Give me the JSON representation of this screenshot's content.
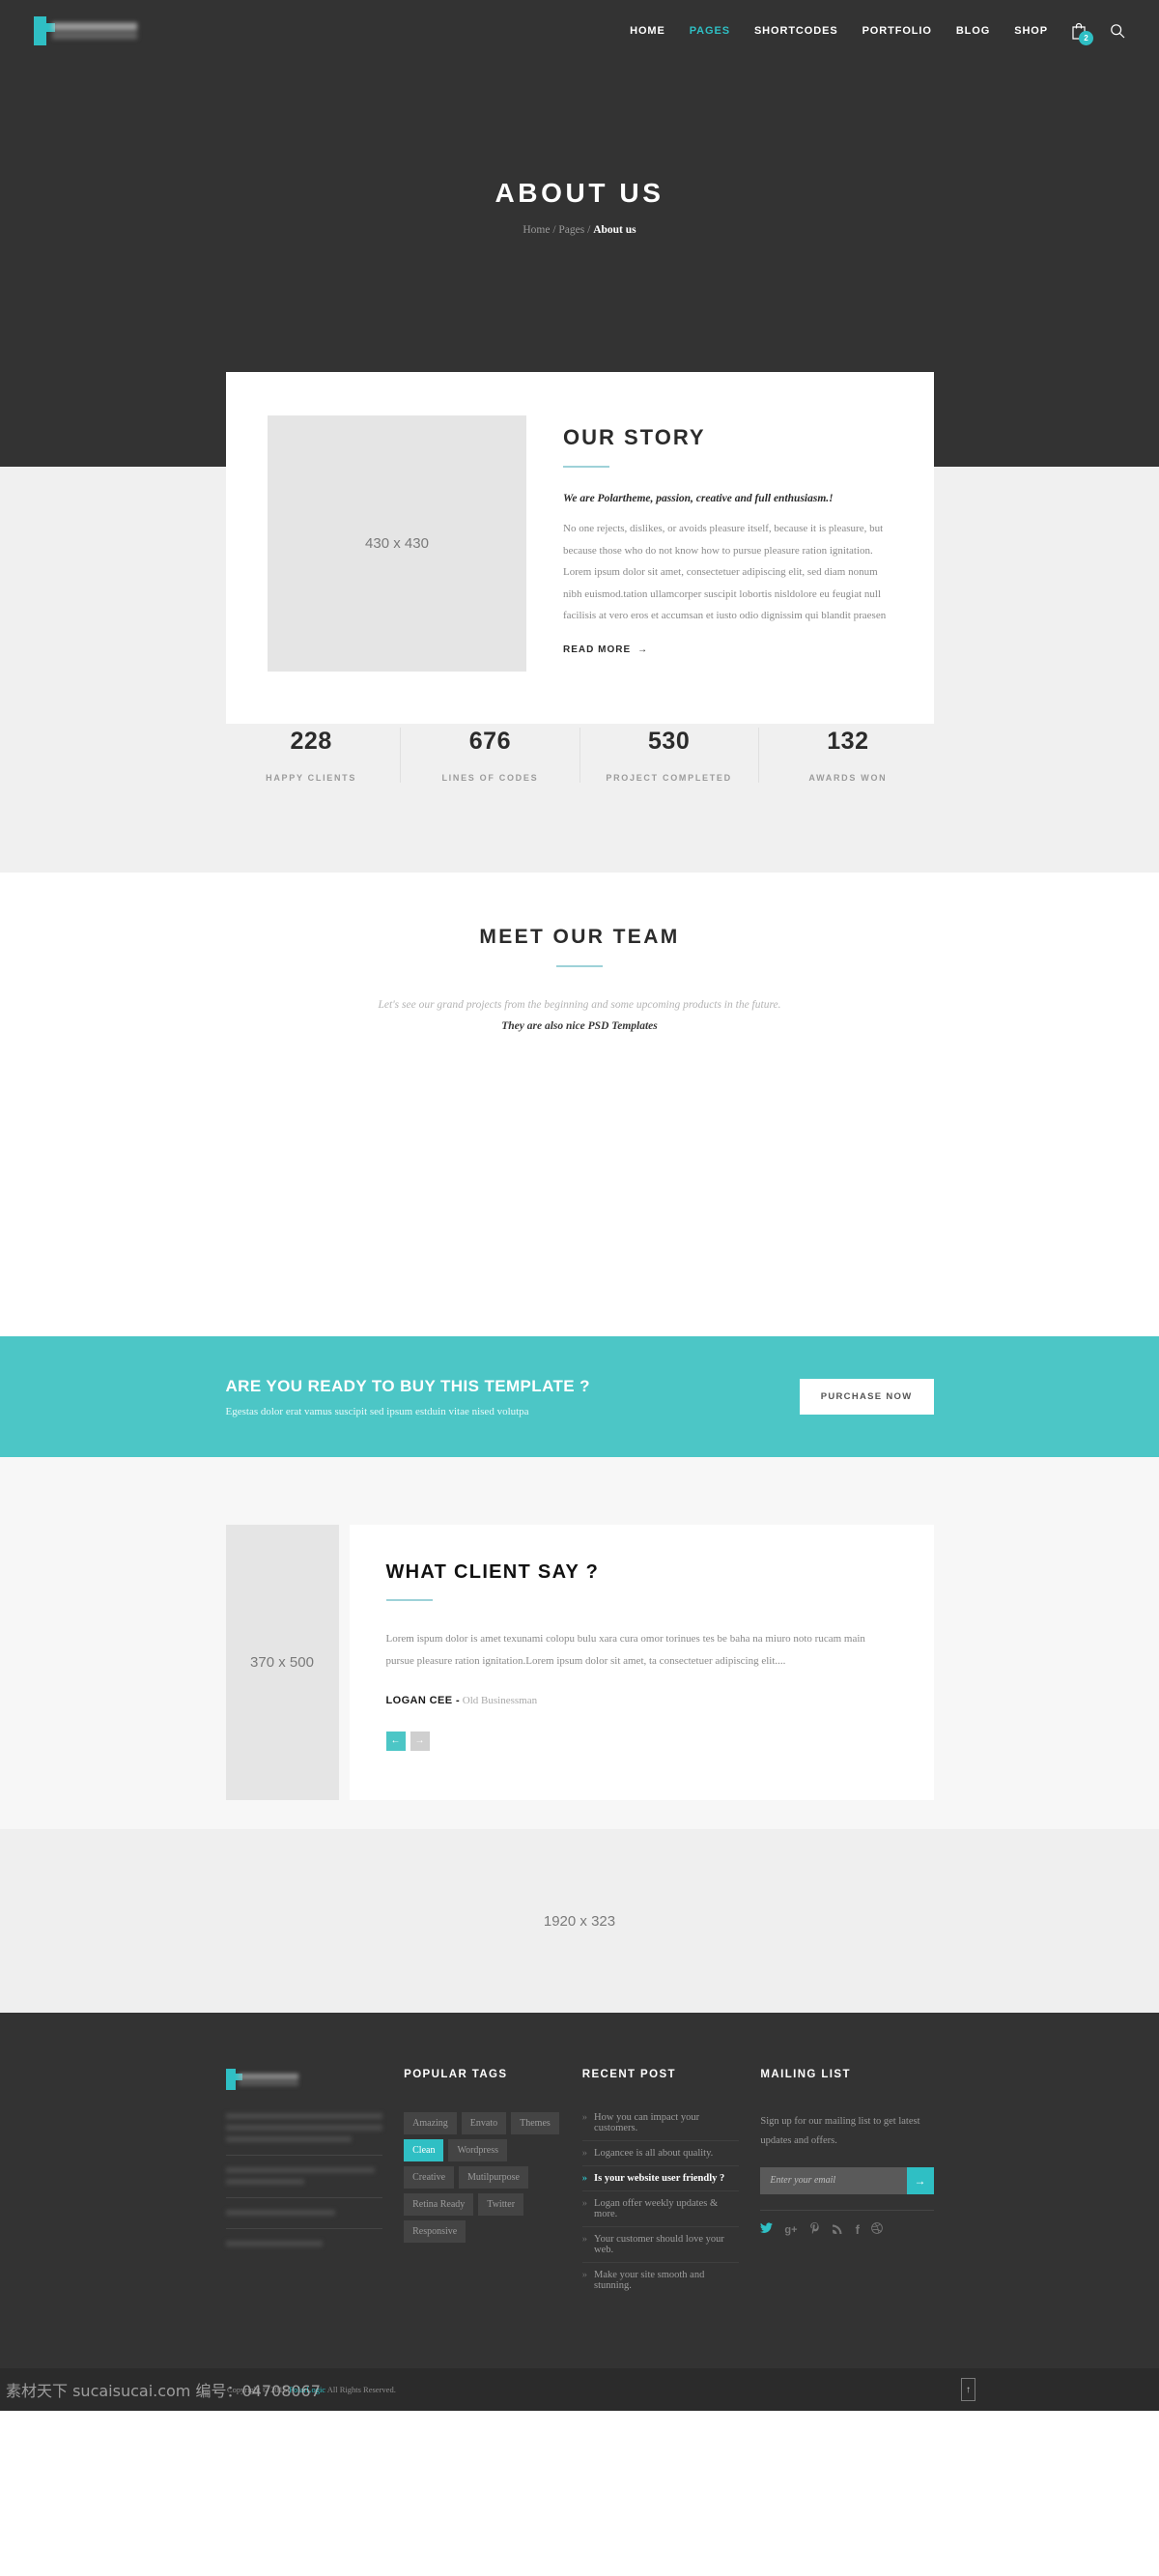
{
  "colors": {
    "accent": "#2fbfc4",
    "accent_soft": "#4cc6c6",
    "dark": "#333333",
    "dark_bar": "#2b2b2b",
    "rule": "#9ed2d8"
  },
  "header": {
    "logo_alt": "polar-logo",
    "nav": [
      {
        "label": "HOME",
        "active": false
      },
      {
        "label": "PAGES",
        "active": true
      },
      {
        "label": "SHORTCODES",
        "active": false
      },
      {
        "label": "PORTFOLIO",
        "active": false
      },
      {
        "label": "BLOG",
        "active": false
      },
      {
        "label": "SHOP",
        "active": false
      }
    ],
    "cart_count": "2"
  },
  "hero": {
    "title": "ABOUT US",
    "breadcrumb": {
      "home": "Home",
      "sep1": "/",
      "pages": "Pages",
      "sep2": "/",
      "current": "About us"
    }
  },
  "story": {
    "image_placeholder": "430 x 430",
    "title": "OUR STORY",
    "lead": "We are Polartheme, passion, creative and full enthusiasm.!",
    "body": "No one rejects, dislikes, or avoids pleasure itself, because it is pleasure, but because those who do not know how to pursue pleasure ration ignitation. Lorem ipsum dolor sit amet, consectetuer adipiscing elit, sed diam nonum nibh euismod.tation ullamcorper suscipit lobortis nisldolore eu feugiat null facilisis at vero eros et accumsan et iusto odio dignissim qui blandit praesen",
    "read_more": "READ MORE",
    "read_more_arrow": "→"
  },
  "counters": [
    {
      "value": "228",
      "label": "HAPPY CLIENTS"
    },
    {
      "value": "676",
      "label": "LINES OF CODES"
    },
    {
      "value": "530",
      "label": "PROJECT COMPLETED"
    },
    {
      "value": "132",
      "label": "AWARDS WON"
    }
  ],
  "team": {
    "title": "MEET OUR TEAM",
    "subtitle": "Let's see our grand projects from the beginning and some upcoming products in the future.",
    "subtitle2": "They are also nice PSD Templates"
  },
  "cta": {
    "title": "ARE YOU READY TO BUY THIS TEMPLATE ?",
    "subtitle": "Egestas dolor erat vamus suscipit sed ipsum estduin vitae nised volutpa",
    "button": "PURCHASE NOW"
  },
  "testimonial": {
    "image_placeholder": "370 x 500",
    "title": "WHAT CLIENT SAY ?",
    "body": "Lorem ispum dolor is amet texunami colopu bulu xara cura omor torinues tes be baha na miuro noto rucam main pursue pleasure ration ignitation.Lorem ipsum dolor sit amet, ta consectetuer adipiscing elit....",
    "author": "LOGAN CEE -",
    "role": " Old Businessman",
    "prev_icon": "←",
    "next_icon": "→"
  },
  "wide_placeholder": "1920 x 323",
  "footer": {
    "tags_heading": "POPULAR TAGS",
    "tags": [
      {
        "label": "Amazing",
        "active": false
      },
      {
        "label": "Envato",
        "active": false
      },
      {
        "label": "Themes",
        "active": false
      },
      {
        "label": "Clean",
        "active": true
      },
      {
        "label": "Wordpress",
        "active": false
      },
      {
        "label": "Creative",
        "active": false
      },
      {
        "label": "Mutilpurpose",
        "active": false
      },
      {
        "label": "Retina Ready",
        "active": false
      },
      {
        "label": "Twitter",
        "active": false
      },
      {
        "label": "Responsive",
        "active": false
      }
    ],
    "posts_heading": "RECENT POST",
    "posts": [
      {
        "label": "How you can impact your customers.",
        "active": false
      },
      {
        "label": "Logancee is all about quality.",
        "active": false
      },
      {
        "label": "Is your website user friendly ?",
        "active": true
      },
      {
        "label": "Logan offer weekly updates & more.",
        "active": false
      },
      {
        "label": "Your customer should love your web.",
        "active": false
      },
      {
        "label": "Make your site smooth and stunning.",
        "active": false
      }
    ],
    "mail_heading": "MAILING LIST",
    "mail_text": "Sign up for our mailing list to get latest updates and offers.",
    "mail_placeholder": "Enter your email",
    "mail_button_icon": "→",
    "socials": [
      {
        "name": "twitter",
        "glyph": "🐦"
      },
      {
        "name": "google-plus",
        "glyph": "g+"
      },
      {
        "name": "pinterest",
        "glyph": "𝒫"
      },
      {
        "name": "rss",
        "glyph": "ᯤ"
      },
      {
        "name": "facebook",
        "glyph": "f"
      },
      {
        "name": "dribbble",
        "glyph": "◉"
      }
    ]
  },
  "bottom": {
    "copyright_pre": "Copyright © 2015 ",
    "copyright_brand": "PolarLogic",
    "copyright_post": " All Rights Reserved.",
    "to_top_icon": "↑",
    "watermark": "素材天下 sucaisucai.com 编号：04708067"
  }
}
